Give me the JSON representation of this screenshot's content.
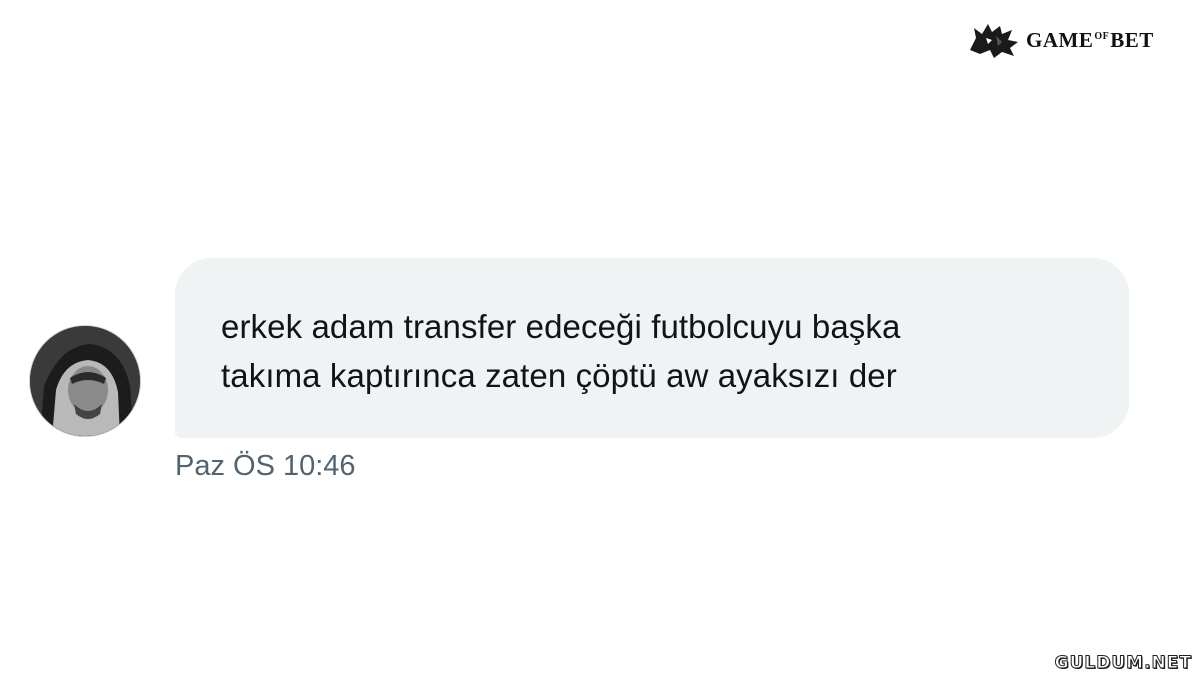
{
  "brand": {
    "logo_icon": "wolf-head-icon",
    "name_left": "GAME",
    "name_mid": "OF",
    "name_right": "BET"
  },
  "conversation": {
    "avatar_icon": "user-avatar",
    "message": {
      "text": "erkek adam transfer edeceği futbolcuyu başka\ntakıma kaptırınca zaten çöptü aw ayaksızı der",
      "timestamp": "Paz ÖS 10:46"
    }
  },
  "watermark": {
    "text": "GULDUM.NET"
  },
  "colors": {
    "bubble_bg": "#eff3f4",
    "message_text": "#0f1419",
    "timestamp_text": "#536471"
  }
}
